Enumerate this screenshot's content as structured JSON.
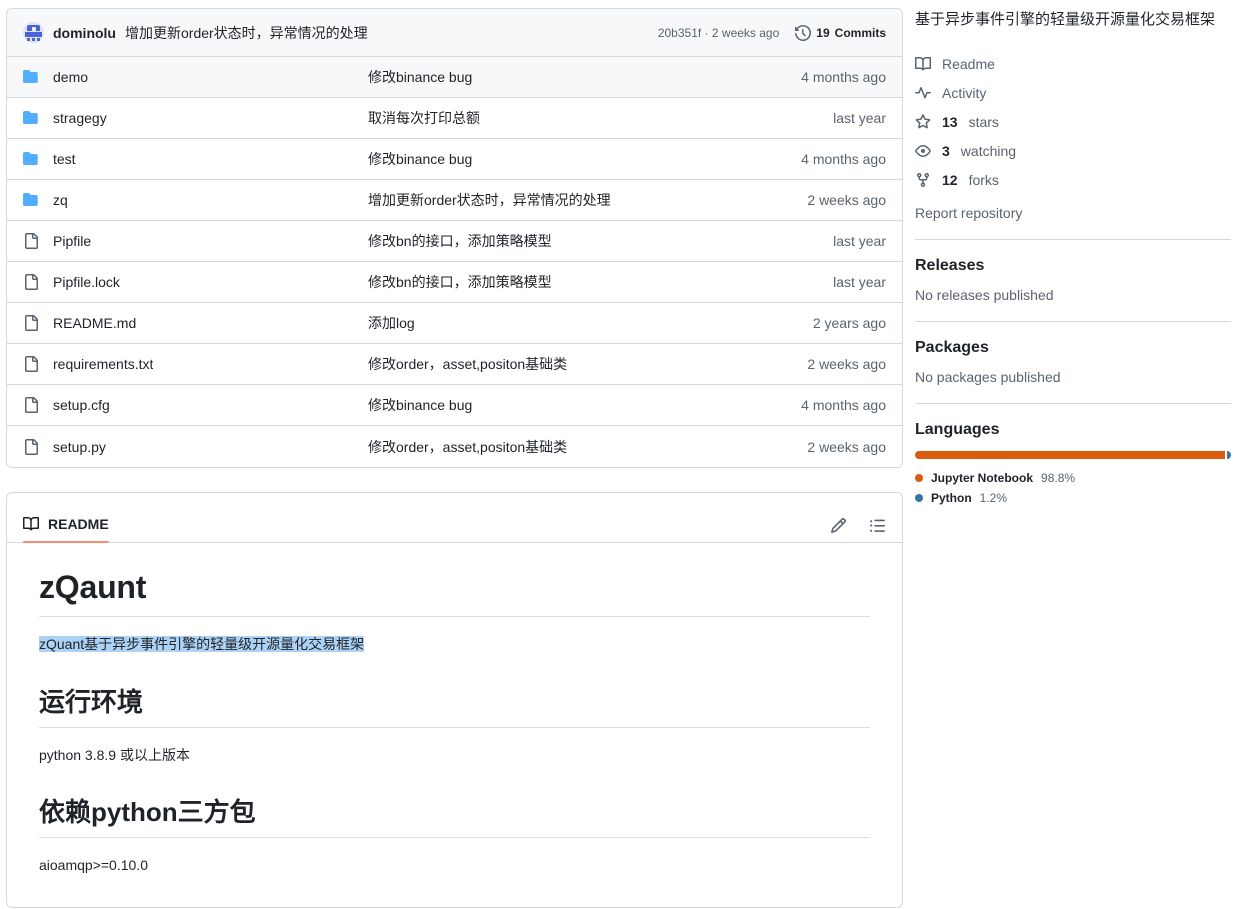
{
  "commit_header": {
    "avatar_name": "user-avatar",
    "author": "dominolu",
    "message": "增加更新order状态时，异常情况的处理",
    "hash": "20b351f",
    "relative_time": "2 weeks ago",
    "meta_separator": "·",
    "commits_count": "19",
    "commits_label": "Commits",
    "history_icon": "history-clock-icon"
  },
  "file_table": {
    "rows": [
      {
        "name": "demo",
        "type": "folder",
        "message": "修改binance bug",
        "time": "4 months ago",
        "active": true
      },
      {
        "name": "stragegy",
        "type": "folder",
        "message": "取消每次打印总额",
        "time": "last year",
        "active": false
      },
      {
        "name": "test",
        "type": "folder",
        "message": "修改binance bug",
        "time": "4 months ago",
        "active": false
      },
      {
        "name": "zq",
        "type": "folder",
        "message": "增加更新order状态时，异常情况的处理",
        "time": "2 weeks ago",
        "active": false
      },
      {
        "name": "Pipfile",
        "type": "file",
        "message": "修改bn的接口，添加策略模型",
        "time": "last year",
        "active": false
      },
      {
        "name": "Pipfile.lock",
        "type": "file",
        "message": "修改bn的接口，添加策略模型",
        "time": "last year",
        "active": false
      },
      {
        "name": "README.md",
        "type": "file",
        "message": "添加log",
        "time": "2 years ago",
        "active": false
      },
      {
        "name": "requirements.txt",
        "type": "file",
        "message": "修改order，asset,positon基础类",
        "time": "2 weeks ago",
        "active": false
      },
      {
        "name": "setup.cfg",
        "type": "file",
        "message": "修改binance bug",
        "time": "4 months ago",
        "active": false
      },
      {
        "name": "setup.py",
        "type": "file",
        "message": "修改order，asset,positon基础类",
        "time": "2 weeks ago",
        "active": false
      }
    ]
  },
  "readme": {
    "tab_label": "README",
    "tab_icon": "book-icon",
    "edit_icon": "pencil-icon",
    "outline_icon": "list-unordered-icon",
    "accent_underline_color": "#fd8c73",
    "heading1": "zQaunt",
    "description": "zQuant基于异步事件引擎的轻量级开源量化交易框架",
    "description_selected": true,
    "selection_color": "#aed2f6",
    "heading2_env": "运行环境",
    "env_text": "python 3.8.9 或以上版本",
    "heading2_deps": "依赖python三方包",
    "deps_text": "aioamqp>=0.10.0"
  },
  "sidebar": {
    "description": "基于异步事件引擎的轻量级开源量化交易框架",
    "stats": [
      {
        "icon": "book-icon",
        "num": "",
        "text": "Readme"
      },
      {
        "icon": "pulse-icon",
        "num": "",
        "text": "Activity"
      },
      {
        "icon": "star-icon",
        "num": "13",
        "text": "stars"
      },
      {
        "icon": "eye-icon",
        "num": "3",
        "text": "watching"
      },
      {
        "icon": "repo-forked-icon",
        "num": "12",
        "text": "forks"
      }
    ],
    "report_link": "Report repository",
    "releases": {
      "title": "Releases",
      "empty": "No releases published"
    },
    "packages": {
      "title": "Packages",
      "empty": "No packages published"
    },
    "languages": {
      "title": "Languages",
      "items": [
        {
          "name": "Jupyter Notebook",
          "pct": "98.8%",
          "value": 98.8,
          "color": "#da5b0b"
        },
        {
          "name": "Python",
          "pct": "1.2%",
          "value": 1.2,
          "color": "#3572a5"
        }
      ]
    }
  }
}
